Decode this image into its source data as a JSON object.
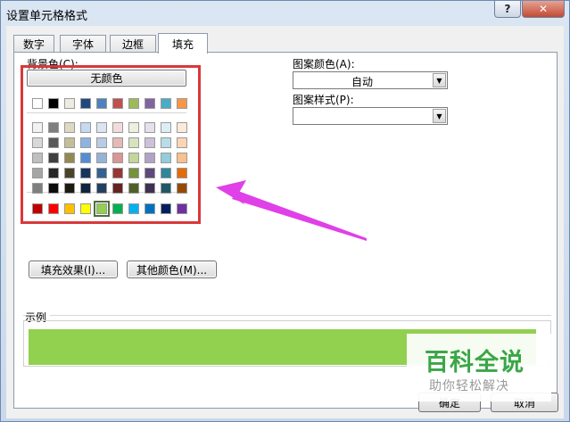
{
  "window": {
    "title": "设置单元格格式",
    "help_label": "?",
    "close_label": "✕"
  },
  "tabs": [
    {
      "label": "数字",
      "active": false
    },
    {
      "label": "字体",
      "active": false
    },
    {
      "label": "边框",
      "active": false
    },
    {
      "label": "填充",
      "active": true
    }
  ],
  "fill": {
    "background_label": "背景色(C):",
    "no_color_label": "无颜色",
    "theme_top_row": [
      "#ffffff",
      "#000000",
      "#eeece1",
      "#1f497d",
      "#4f81bd",
      "#c0504d",
      "#9bbb59",
      "#8064a2",
      "#4bacc6",
      "#f79646"
    ],
    "theme_shades": [
      [
        "#f2f2f2",
        "#7f7f7f",
        "#ddd9c3",
        "#c6d9f0",
        "#dbe5f1",
        "#f2dcdb",
        "#ebf1dd",
        "#e5e0ec",
        "#dbeef3",
        "#fdeada"
      ],
      [
        "#d8d8d8",
        "#595959",
        "#c4bd97",
        "#8db3e2",
        "#b8cce4",
        "#e5b9b7",
        "#d7e3bc",
        "#ccc1d9",
        "#b7dde8",
        "#fbd5b5"
      ],
      [
        "#bfbfbf",
        "#3f3f3f",
        "#938953",
        "#548dd4",
        "#95b3d7",
        "#d99694",
        "#c3d69b",
        "#b2a2c7",
        "#92cddc",
        "#fac08f"
      ],
      [
        "#a5a5a5",
        "#262626",
        "#494429",
        "#17365d",
        "#366092",
        "#953734",
        "#76923c",
        "#5f497a",
        "#31859b",
        "#e36c09"
      ],
      [
        "#7f7f7f",
        "#0c0c0c",
        "#1d1b10",
        "#0f243e",
        "#244061",
        "#632423",
        "#4f6128",
        "#3f3151",
        "#205867",
        "#974806"
      ]
    ],
    "standard_colors": [
      "#c00000",
      "#ff0000",
      "#ffc000",
      "#ffff00",
      "#92d050",
      "#00b050",
      "#00b0f0",
      "#0070c0",
      "#002060",
      "#7030a0"
    ],
    "selected_standard_index": 4,
    "fill_effects_label": "填充效果(I)...",
    "more_colors_label": "其他颜色(M)...",
    "pattern_color_label": "图案颜色(A):",
    "pattern_color_value": "自动",
    "pattern_style_label": "图案样式(P):",
    "pattern_style_value": "",
    "sample_label": "示例",
    "sample_color": "#92d050",
    "highlight_color": "#d9383a",
    "arrow_color": "#e040e8"
  },
  "buttons": {
    "ok_label": "确定",
    "cancel_label": "取消"
  },
  "watermark": {
    "main": "百科全说",
    "sub": "助你轻松解决"
  }
}
